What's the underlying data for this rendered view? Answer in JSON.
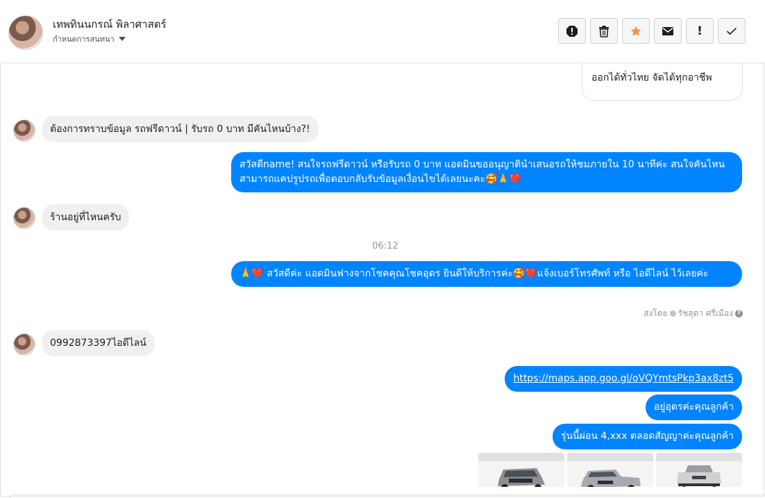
{
  "header": {
    "contact_name": "เทพทินนกรณ์ พิลาศาสตร์",
    "subtitle": "กำหนดการสนทนา",
    "toolbar": [
      {
        "name": "report-icon"
      },
      {
        "name": "trash-icon"
      },
      {
        "name": "star-icon",
        "color": "#f7923b"
      },
      {
        "name": "mail-icon"
      },
      {
        "name": "exclamation-icon",
        "label": "!"
      },
      {
        "name": "check-icon"
      }
    ]
  },
  "messages": {
    "m0_out": "ออกได้ทั่วไทย จัดได้ทุกอาชีพ",
    "m1_in": "ต้องการทราบข้อมูล รถฟรีดาวน์ | รับรถ 0 บาท มีคันไหนบ้าง?!",
    "m2_out": "สวัสดีname! สนใจรถฟรีดาวน์ หรือรับรถ 0 บาท แอดมินขออนุญาตินำเสนอรถให้ชมภายใน 10 นาทีค่ะ สนใจคันไหนสามารถแคปรูปรถเพื่อตอบกลับรับข้อมูลเงื่อนไขได้เลยนะคะ🥰🙏❤️",
    "m3_in": "ร้านอยู่ที่ไหนครับ",
    "timestamp": "06:12",
    "m4_out": "🙏❤️ สวัสดีค่ะ แอดมินฟางจากโชคคุณโชคอุดร ยินดีให้บริการค่ะ🥰❤️แจ้งเบอร์โทรศัพท์ หรือ ไอดีไลน์  ไว้เลยค่ะ",
    "sent_by": "ส่งโดย",
    "sender_name": "รัชสุดา ศรีเมือง",
    "m5_in": "0992873397ไอดีไลน์",
    "m6_link": "https://maps.app.goo.gl/oVQYmtsPkp3ax8zt5",
    "m7_out": "อยู่อุดรค่ะคุณลูกค้า",
    "m8_out": "รุ่นนี้ผ่อน 4,xxx ตลอดสัญญาค่ะคุณลูกค้า"
  },
  "colors": {
    "outgoing_bubble": "#0084ff",
    "incoming_bubble": "#f1f0f0",
    "star": "#f7923b"
  }
}
